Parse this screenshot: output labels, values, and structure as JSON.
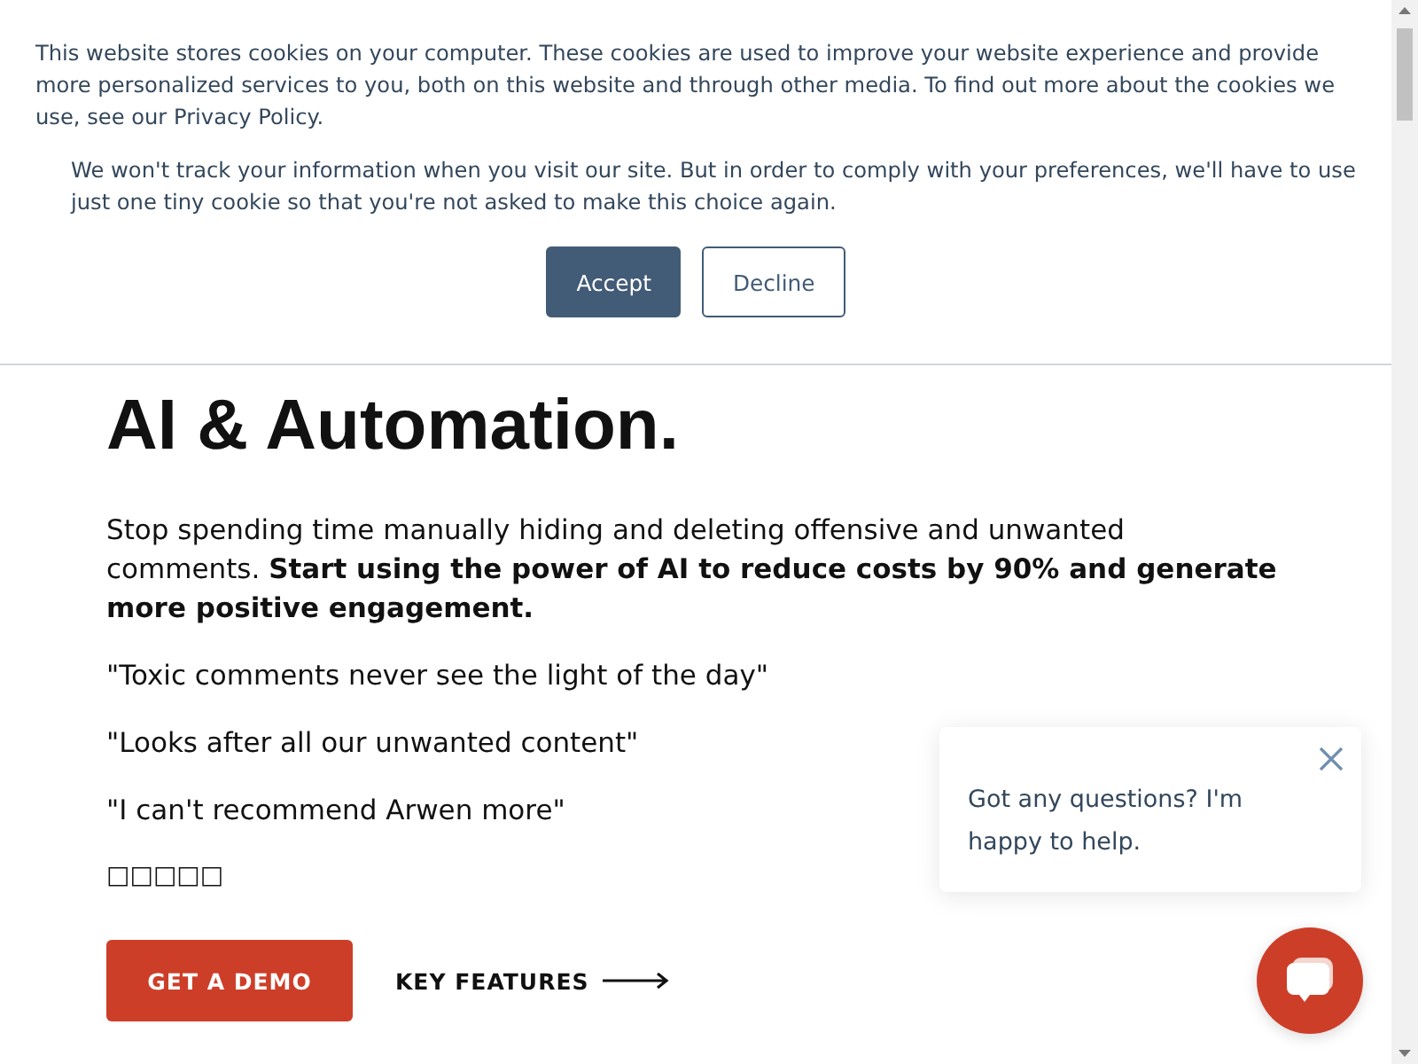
{
  "cookie_banner": {
    "paragraphs": [
      "This website stores cookies on your computer. These cookies are used to improve your website experience and provide more personalized services to you, both on this website and through other media. To find out more about the cookies we use, see our Privacy Policy.",
      "We won't track your information when you visit our site. But in order to comply with your preferences, we'll have to use just one tiny cookie so that you're not asked to make this choice again."
    ],
    "buttons": [
      {
        "label": "Accept",
        "kind": "primary"
      },
      {
        "label": "Decline",
        "kind": "outline"
      }
    ]
  },
  "hero": {
    "heading": "AI & Automation.",
    "intro": "Stop spending time manually hiding and deleting offensive and unwanted comments. **Start using the power of AI to reduce costs by 90% and generate more positive engagement.**",
    "quotes": [
      "\"Toxic comments never see the light of the day\"",
      "\"Looks after all our unwanted content\"",
      "\"I can't recommend Arwen more\""
    ],
    "rating_text": "□□□□□",
    "primary_button": "GET A DEMO",
    "link": "KEY FEATURES"
  },
  "chat": {
    "message": "Got any questions? I'm happy to help."
  }
}
